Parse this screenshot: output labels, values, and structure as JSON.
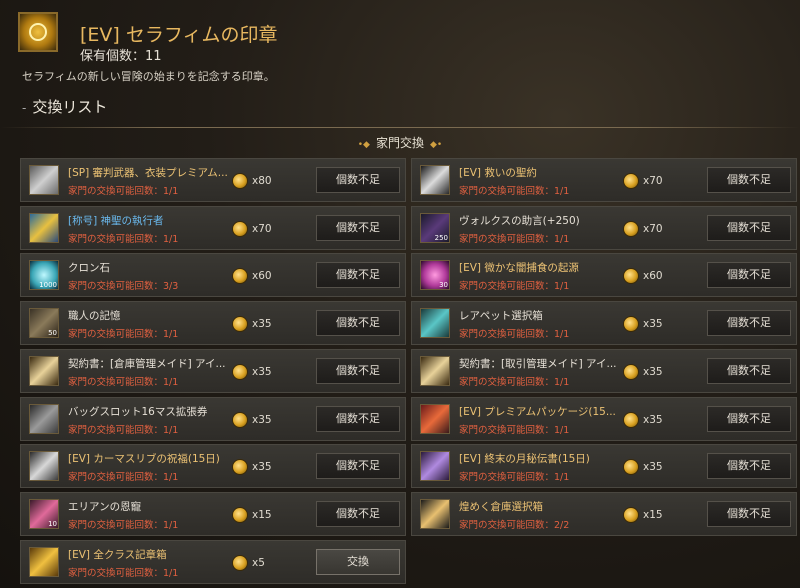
{
  "header": {
    "title": "[EV] セラフィムの印章",
    "owned": "保有個数：11",
    "description": "セラフィムの新しい冒険の始まりを記念する印章。",
    "section_title": "交換リスト"
  },
  "category": "家門交換",
  "items": [
    {
      "name": "[SP] 審判武器、衣装プレミアム...",
      "limit": "家門の交換可能回数：1/1",
      "cost": "x80",
      "button": "個数不足",
      "color": "gold",
      "icon": "chest-icon"
    },
    {
      "name": "[EV] 救いの聖約",
      "limit": "家門の交換可能回数：1/1",
      "cost": "x70",
      "button": "個数不足",
      "color": "gold",
      "icon": "scroll-icon"
    },
    {
      "name": "[称号] 神聖の執行者",
      "limit": "家門の交換可能回数：1/1",
      "cost": "x70",
      "button": "個数不足",
      "color": "blue",
      "icon": "title-tag-icon"
    },
    {
      "name": "ヴォルクスの助言(+250)",
      "limit": "家門の交換可能回数：1/1",
      "cost": "x70",
      "button": "個数不足",
      "color": "grey",
      "icon": "book-icon",
      "icon_label": "250"
    },
    {
      "name": "クロン石",
      "limit": "家門の交換可能回数：3/3",
      "cost": "x60",
      "button": "個数不足",
      "color": "grey",
      "icon": "cron-stone-icon",
      "icon_label": "1000"
    },
    {
      "name": "[EV] 微かな闇捕食の起源",
      "limit": "家門の交換可能回数：1/1",
      "cost": "x60",
      "button": "個数不足",
      "color": "gold",
      "icon": "vortex-icon",
      "icon_label": "30"
    },
    {
      "name": "職人の記憶",
      "limit": "家門の交換可能回数：1/1",
      "cost": "x35",
      "button": "個数不足",
      "color": "grey",
      "icon": "memory-icon",
      "icon_label": "50"
    },
    {
      "name": "レアペット選択箱",
      "limit": "家門の交換可能回数：1/1",
      "cost": "x35",
      "button": "個数不足",
      "color": "grey",
      "icon": "pet-box-icon"
    },
    {
      "name": "契約書：[倉庫管理メイド] アイ...",
      "limit": "家門の交換可能回数：1/1",
      "cost": "x35",
      "button": "個数不足",
      "color": "grey",
      "icon": "contract-icon"
    },
    {
      "name": "契約書：[取引管理メイド] アイ...",
      "limit": "家門の交換可能回数：1/1",
      "cost": "x35",
      "button": "個数不足",
      "color": "grey",
      "icon": "contract-icon"
    },
    {
      "name": "バッグスロット16マス拡張券",
      "limit": "家門の交換可能回数：1/1",
      "cost": "x35",
      "button": "個数不足",
      "color": "grey",
      "icon": "bag-icon"
    },
    {
      "name": "[EV] プレミアムパッケージ(15...",
      "limit": "家門の交換可能回数：1/1",
      "cost": "x35",
      "button": "個数不足",
      "color": "gold",
      "icon": "package-icon"
    },
    {
      "name": "[EV] カーマスリブの祝福(15日)",
      "limit": "家門の交換可能回数：1/1",
      "cost": "x35",
      "button": "個数不足",
      "color": "gold",
      "icon": "tree-icon"
    },
    {
      "name": "[EV] 終末の月秘伝書(15日)",
      "limit": "家門の交換可能回数：1/1",
      "cost": "x35",
      "button": "個数不足",
      "color": "gold",
      "icon": "secret-book-icon"
    },
    {
      "name": "エリアンの恩寵",
      "limit": "家門の交換可能回数：1/1",
      "cost": "x15",
      "button": "個数不足",
      "color": "grey",
      "icon": "potion-icon",
      "icon_label": "10"
    },
    {
      "name": "煌めく倉庫選択箱",
      "limit": "家門の交換可能回数：2/2",
      "cost": "x15",
      "button": "個数不足",
      "color": "gold",
      "icon": "lamp-icon"
    },
    {
      "name": "[EV] 全クラス記章箱",
      "limit": "家門の交換可能回数：1/1",
      "cost": "x5",
      "button": "交換",
      "color": "gold",
      "icon": "treasure-chest-icon",
      "active": true
    }
  ],
  "colors": {
    "gold_text": "#ecc274",
    "blue_text": "#6ab8ec",
    "limit_text": "#e06040",
    "coin": "#d8a020"
  }
}
